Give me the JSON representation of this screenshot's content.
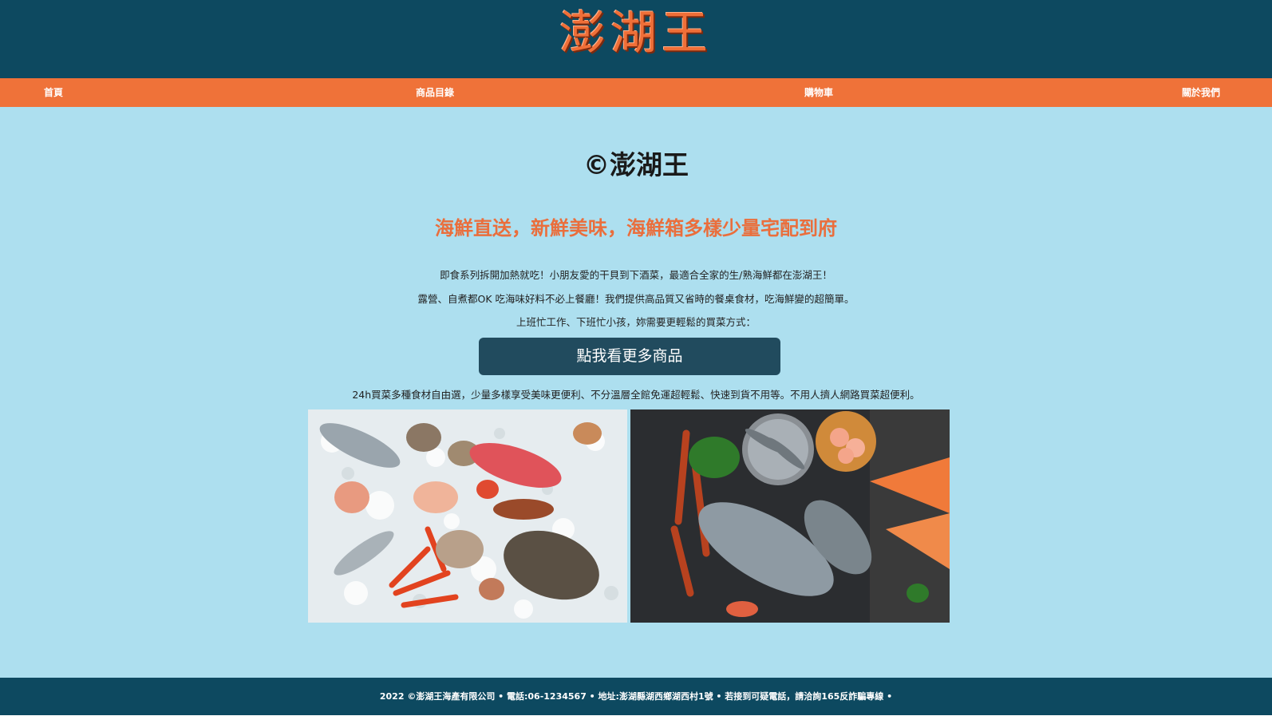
{
  "header": {
    "logo_text": "澎湖王"
  },
  "nav": {
    "home": "首頁",
    "catalog": "商品目錄",
    "cart": "購物車",
    "about": "關於我們"
  },
  "main": {
    "brand_title": "©澎湖王",
    "tagline": "海鮮直送，新鮮美味，海鮮箱多樣少量宅配到府",
    "desc_1": "即食系列拆開加熱就吃！小朋友愛的干貝到下酒菜，最適合全家的生/熟海鮮都在澎湖王！",
    "desc_2": "露營、自煮都OK 吃海味好料不必上餐廳！我們提供高品質又省時的餐桌食材，吃海鮮變的超簡單。",
    "desc_3": "上班忙工作、下班忙小孩，妳需要更輕鬆的買菜方式：",
    "more_button": "點我看更多商品",
    "features": "24h買菜多種食材自由選，少量多樣享受美味更便利、不分溫層全館免運超輕鬆、快速到貨不用等。不用人擠人網路買菜超便利。"
  },
  "footer": {
    "text": "2022 ©澎湖王海產有限公司 • 電話:06-1234567 • 地址:澎湖縣湖西鄉湖西村1號 • 若接到可疑電話，請洽詢165反詐騙專線 •"
  },
  "colors": {
    "header_bg": "#0d4960",
    "nav_bg": "#ef7239",
    "main_bg": "#addfef",
    "accent": "#ea6e3c",
    "button_bg": "#214b5e"
  }
}
